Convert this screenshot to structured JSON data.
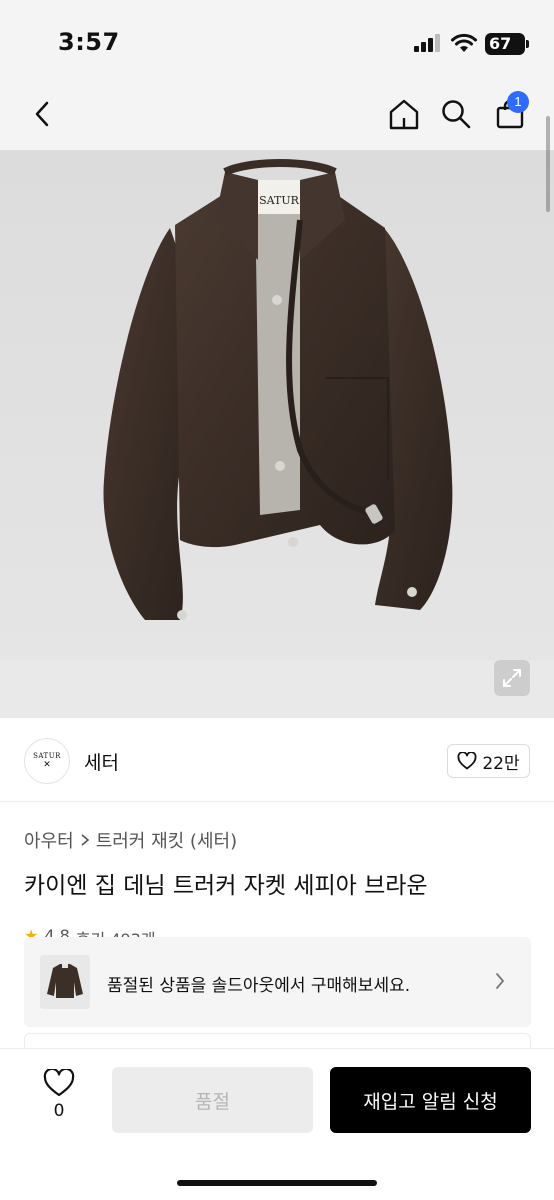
{
  "status_bar": {
    "time": "3:57",
    "battery": "67"
  },
  "nav": {
    "cart_badge": "1",
    "icons": [
      "back-icon",
      "home-icon",
      "search-icon",
      "shopping-bag-icon"
    ]
  },
  "product_image": {
    "logo_tag": "SATUR"
  },
  "brand": {
    "logo_text": "SATUR",
    "logo_mark": "✕",
    "name": "세터",
    "likes": "22만"
  },
  "breadcrumb": {
    "category": "아우터",
    "subcategory": "트러커 재킷 (세터)"
  },
  "product": {
    "title": "카이엔 집 데님 트러커 자켓 세피아 브라운"
  },
  "rating": {
    "score": "4.8",
    "reviews": "후기 493개"
  },
  "soldout_banner": {
    "text": "품절된 상품을 솔드아웃에서 구매해보세요."
  },
  "bottom_bar": {
    "wish_count": "0",
    "soldout_label": "품절",
    "restock_label": "재입고 알림 신청"
  },
  "colors": {
    "accent_blue": "#2f6bff",
    "primary_black": "#000000",
    "disabled_gray": "#ececec",
    "jacket_brown": "#3b2f28"
  }
}
